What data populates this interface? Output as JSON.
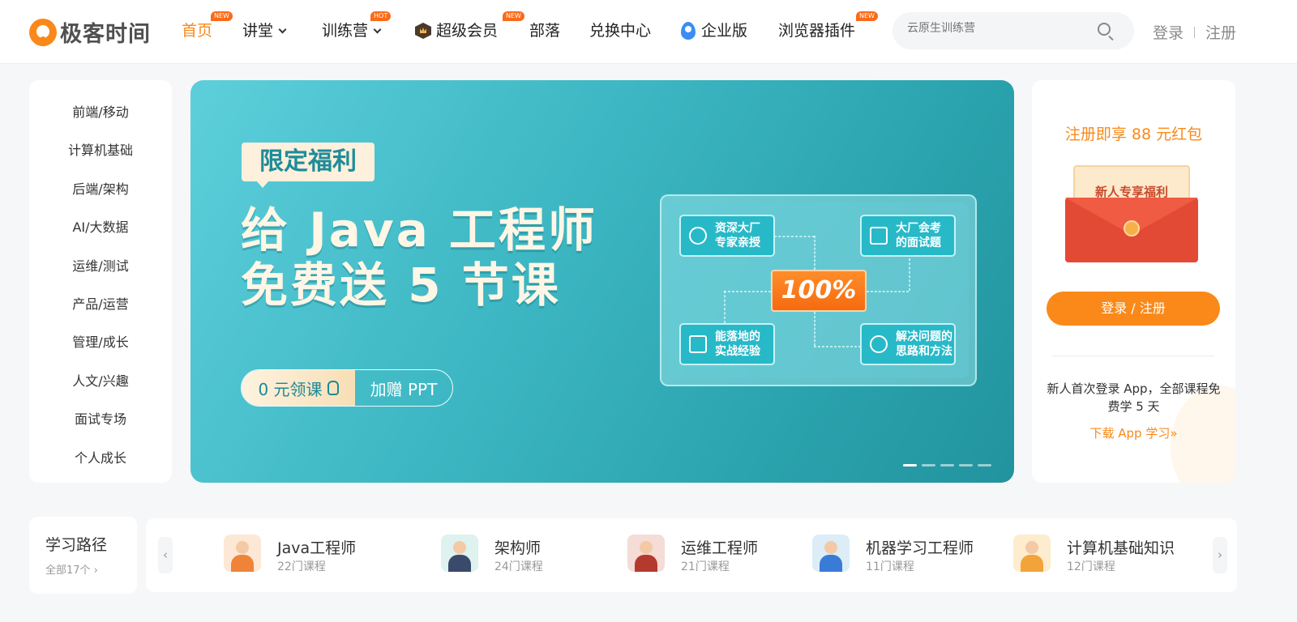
{
  "header": {
    "logo_text": "极客时间",
    "nav": [
      {
        "label": "首页",
        "badge": "NEW",
        "active": true
      },
      {
        "label": "讲堂",
        "dropdown": true
      },
      {
        "label": "训练营",
        "badge": "HOT",
        "dropdown": true
      },
      {
        "label": "超级会员",
        "badge": "NEW",
        "icon": "crown-icon"
      },
      {
        "label": "部落"
      },
      {
        "label": "兑换中心"
      },
      {
        "label": "企业版",
        "icon": "enterprise-icon"
      },
      {
        "label": "浏览器插件",
        "badge": "NEW"
      }
    ],
    "search_placeholder": "云原生训练营",
    "login": "登录",
    "register": "注册"
  },
  "categories": [
    "前端/移动",
    "计算机基础",
    "后端/架构",
    "AI/大数据",
    "运维/测试",
    "产品/运营",
    "管理/成长",
    "人文/兴趣",
    "面试专场",
    "个人成长"
  ],
  "banner": {
    "tag": "限定福利",
    "headline_1": "给 Java 工程师",
    "headline_2": "免费送 5 节课",
    "cta_primary": "0 元领课",
    "cta_secondary": "加赠 PPT",
    "features": [
      {
        "l1": "资深大厂",
        "l2": "专家亲授",
        "icon": "expert-icon"
      },
      {
        "l1": "大厂会考",
        "l2": "的面试题",
        "icon": "building-icon"
      },
      {
        "l1": "能落地的",
        "l2": "实战经验",
        "icon": "briefcase-icon"
      },
      {
        "l1": "解决问题的",
        "l2": "思路和方法",
        "icon": "compass-icon"
      }
    ],
    "center_label": "100%",
    "slide_count": 5,
    "active_slide": 1
  },
  "promo": {
    "title": "注册即享 88 元红包",
    "envelope_label": "新人专享福利",
    "button": "登录 / 注册",
    "text": "新人首次登录 App，全部课程免费学 5 天",
    "link": "下载 App 学习»"
  },
  "learning_path": {
    "title": "学习路径",
    "all_link": "全部17个 ›",
    "prev": "‹",
    "next": "›",
    "items": [
      {
        "name": "Java工程师",
        "count": "22门课程",
        "color": "#f0833a"
      },
      {
        "name": "架构师",
        "count": "24门课程",
        "color": "#3a4a6a"
      },
      {
        "name": "运维工程师",
        "count": "21门课程",
        "color": "#b53a2e"
      },
      {
        "name": "机器学习工程师",
        "count": "11门课程",
        "color": "#3a7bd5"
      },
      {
        "name": "计算机基础知识",
        "count": "12门课程",
        "color": "#f2a43a"
      }
    ]
  },
  "colors": {
    "accent": "#fa8919",
    "banner_teal": "#3eb8c4"
  }
}
